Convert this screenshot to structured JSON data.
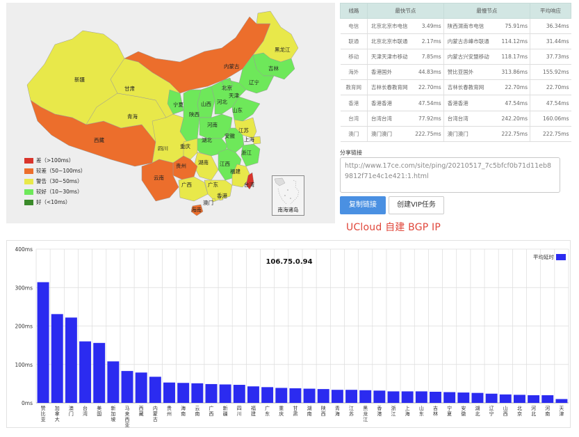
{
  "map": {
    "provinces": [
      {
        "name": "黑龙江",
        "status": "警告",
        "color": "#e8e84a"
      },
      {
        "name": "吉林",
        "status": "较好",
        "color": "#6ee85a"
      },
      {
        "name": "辽宁",
        "status": "较好",
        "color": "#6ee85a"
      },
      {
        "name": "内蒙古",
        "status": "较差",
        "color": "#ec6e2c"
      },
      {
        "name": "新疆",
        "status": "警告",
        "color": "#e8e84a"
      },
      {
        "name": "甘肃",
        "status": "警告",
        "color": "#e8e84a"
      },
      {
        "name": "青海",
        "status": "警告",
        "color": "#e8e84a"
      },
      {
        "name": "西藏",
        "status": "较差",
        "color": "#ec6e2c"
      },
      {
        "name": "四川",
        "status": "警告",
        "color": "#e8e84a"
      },
      {
        "name": "宁夏",
        "status": "较好",
        "color": "#6ee85a"
      },
      {
        "name": "山西",
        "status": "较好",
        "color": "#6ee85a"
      },
      {
        "name": "陕西",
        "status": "较好",
        "color": "#6ee85a"
      },
      {
        "name": "北京",
        "status": "较好",
        "color": "#6ee85a"
      },
      {
        "name": "天津",
        "status": "较好",
        "color": "#6ee85a"
      },
      {
        "name": "河北",
        "status": "较好",
        "color": "#6ee85a"
      },
      {
        "name": "山东",
        "status": "较好",
        "color": "#6ee85a"
      },
      {
        "name": "河南",
        "status": "较好",
        "color": "#6ee85a"
      },
      {
        "name": "江苏",
        "status": "警告",
        "color": "#e8e84a"
      },
      {
        "name": "安徽",
        "status": "较好",
        "color": "#6ee85a"
      },
      {
        "name": "上海",
        "status": "警告",
        "color": "#e8e84a"
      },
      {
        "name": "湖北",
        "status": "较好",
        "color": "#6ee85a"
      },
      {
        "name": "浙江",
        "status": "较好",
        "color": "#6ee85a"
      },
      {
        "name": "重庆",
        "status": "警告",
        "color": "#e8e84a"
      },
      {
        "name": "湖南",
        "status": "警告",
        "color": "#e8e84a"
      },
      {
        "name": "江西",
        "status": "较好",
        "color": "#6ee85a"
      },
      {
        "name": "贵州",
        "status": "较差",
        "color": "#ec6e2c"
      },
      {
        "name": "福建",
        "status": "警告",
        "color": "#e8e84a"
      },
      {
        "name": "云南",
        "status": "较差",
        "color": "#ec6e2c"
      },
      {
        "name": "广西",
        "status": "警告",
        "color": "#e8e84a"
      },
      {
        "name": "广东",
        "status": "警告",
        "color": "#e8e84a"
      },
      {
        "name": "台湾",
        "status": "差",
        "color": "#d9342b"
      },
      {
        "name": "香港",
        "status": "警告",
        "color": "#e8e84a"
      },
      {
        "name": "澳门",
        "status": "警告",
        "color": "#e8e84a"
      },
      {
        "name": "海南",
        "status": "较差",
        "color": "#ec6e2c"
      }
    ],
    "legend": [
      {
        "label": "差（>100ms）",
        "color": "#d9342b"
      },
      {
        "label": "较差（50~100ms）",
        "color": "#ec6e2c"
      },
      {
        "label": "警告（30~50ms）",
        "color": "#e8e84a"
      },
      {
        "label": "较好（10~30ms）",
        "color": "#6ee85a"
      },
      {
        "label": "好（<10ms）",
        "color": "#3a8a2a"
      }
    ],
    "inset_label": "南海诸岛"
  },
  "table": {
    "headers": [
      "线路",
      "最快节点",
      "最慢节点",
      "平均响应"
    ],
    "rows": [
      {
        "line": "电信",
        "fast": "北京北京市电信",
        "fast_ms": "3.49ms",
        "slow": "陕西渭南市电信",
        "slow_ms": "75.91ms",
        "avg": "36.34ms"
      },
      {
        "line": "联通",
        "fast": "北京北京市联通",
        "fast_ms": "2.17ms",
        "slow": "内蒙古赤峰市联通",
        "slow_ms": "114.12ms",
        "avg": "31.44ms"
      },
      {
        "line": "移动",
        "fast": "天津天津市移动",
        "fast_ms": "7.85ms",
        "slow": "内蒙古兴安盟移动",
        "slow_ms": "118.17ms",
        "avg": "37.73ms"
      },
      {
        "line": "海外",
        "fast": "香港国外",
        "fast_ms": "44.83ms",
        "slow": "赞比亚国外",
        "slow_ms": "313.86ms",
        "avg": "155.92ms"
      },
      {
        "line": "教育网",
        "fast": "吉林长春教育网",
        "fast_ms": "22.70ms",
        "slow": "吉林长春教育网",
        "slow_ms": "22.70ms",
        "avg": "22.70ms"
      },
      {
        "line": "香港",
        "fast": "香港香港",
        "fast_ms": "47.54ms",
        "slow": "香港香港",
        "slow_ms": "47.54ms",
        "avg": "47.54ms"
      },
      {
        "line": "台湾",
        "fast": "台湾台湾",
        "fast_ms": "77.92ms",
        "slow": "台湾台湾",
        "slow_ms": "242.20ms",
        "avg": "160.06ms"
      },
      {
        "line": "澳门",
        "fast": "澳门澳门",
        "fast_ms": "222.75ms",
        "slow": "澳门澳门",
        "slow_ms": "222.75ms",
        "avg": "222.75ms"
      }
    ]
  },
  "share": {
    "label": "分享链接",
    "url": "http://www.17ce.com/site/ping/20210517_7c5bfcf0b71d11eb89812f71e4c1e421:1.html",
    "copy_label": "复制链接",
    "vip_label": "创建VIP任务"
  },
  "caption": "UCloud 自建 BGP IP",
  "chart_data": {
    "type": "bar",
    "title": "106.75.0.94",
    "legend": "平均延时",
    "legend_position": "top-right",
    "bar_color": "#2b2bf0",
    "ylim": [
      0,
      400
    ],
    "yticks": [
      "0ms",
      "100ms",
      "200ms",
      "300ms",
      "400ms"
    ],
    "grid": true,
    "categories": [
      "赞比亚",
      "加拿大",
      "澳门",
      "台湾",
      "美国",
      "新加坡",
      "马来西亚",
      "西藏",
      "内蒙古",
      "贵州",
      "海南",
      "云南",
      "广西",
      "新疆",
      "四川",
      "福建",
      "广东",
      "重庆",
      "甘肃",
      "湖南",
      "陕西",
      "青海",
      "江苏",
      "黑龙江",
      "香港",
      "浙江",
      "上海",
      "山东",
      "吉林",
      "宁夏",
      "安徽",
      "湖北",
      "辽宁",
      "山西",
      "北京",
      "河北",
      "河南",
      "天津"
    ],
    "values": [
      314,
      231,
      222,
      160,
      156,
      108,
      83,
      79,
      68,
      53,
      52,
      51,
      49,
      48,
      47,
      43,
      41,
      39,
      38,
      37,
      36,
      34,
      34,
      33,
      32,
      30,
      30,
      30,
      29,
      28,
      27,
      26,
      24,
      22,
      21,
      20,
      20,
      10
    ]
  }
}
